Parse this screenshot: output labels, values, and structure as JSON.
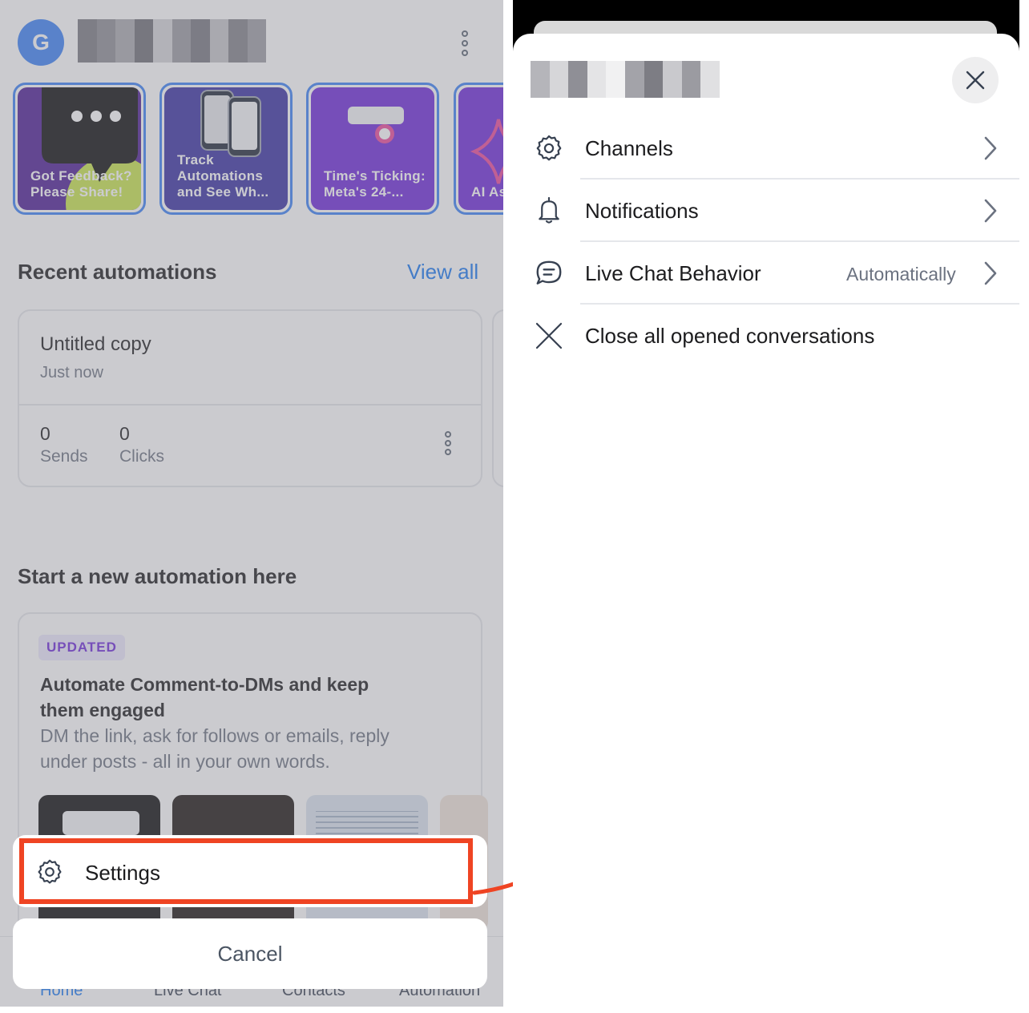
{
  "left": {
    "avatar_letter": "G",
    "stories": [
      {
        "label": "Got Feedback? Please Share!"
      },
      {
        "label": "Track Automations and See Wh..."
      },
      {
        "label": "Time's Ticking: Meta's 24-..."
      },
      {
        "label": "AI As in Liv"
      }
    ],
    "recent": {
      "title": "Recent automations",
      "view_all": "View all",
      "card": {
        "name": "Untitled copy",
        "time": "Just now",
        "sends_value": "0",
        "sends_label": "Sends",
        "clicks_value": "0",
        "clicks_label": "Clicks"
      }
    },
    "new_automation": {
      "title": "Start a new automation here",
      "badge": "UPDATED",
      "heading_line1": "Automate Comment-to-DMs and keep",
      "heading_line2": "them engaged",
      "desc_line1": "DM the link, ask for follows or emails, reply",
      "desc_line2": "under posts - all in your own words."
    },
    "tabbar": [
      "Home",
      "Live Chat",
      "Contacts",
      "Automation"
    ],
    "action_sheet": {
      "settings_label": "Settings",
      "cancel_label": "Cancel"
    }
  },
  "right": {
    "menu": [
      {
        "label": "Channels",
        "icon": "gear-icon",
        "value": ""
      },
      {
        "label": "Notifications",
        "icon": "bell-icon",
        "value": ""
      },
      {
        "label": "Live Chat Behavior",
        "icon": "chat-bubble-icon",
        "value": "Automatically"
      },
      {
        "label": "Close all opened conversations",
        "icon": "close-x-icon",
        "value": ""
      }
    ]
  },
  "colors": {
    "accent_blue": "#1877f2",
    "highlight": "#ef4423",
    "story_purple": "#5b21b6",
    "badge_bg": "#ede9fe"
  }
}
